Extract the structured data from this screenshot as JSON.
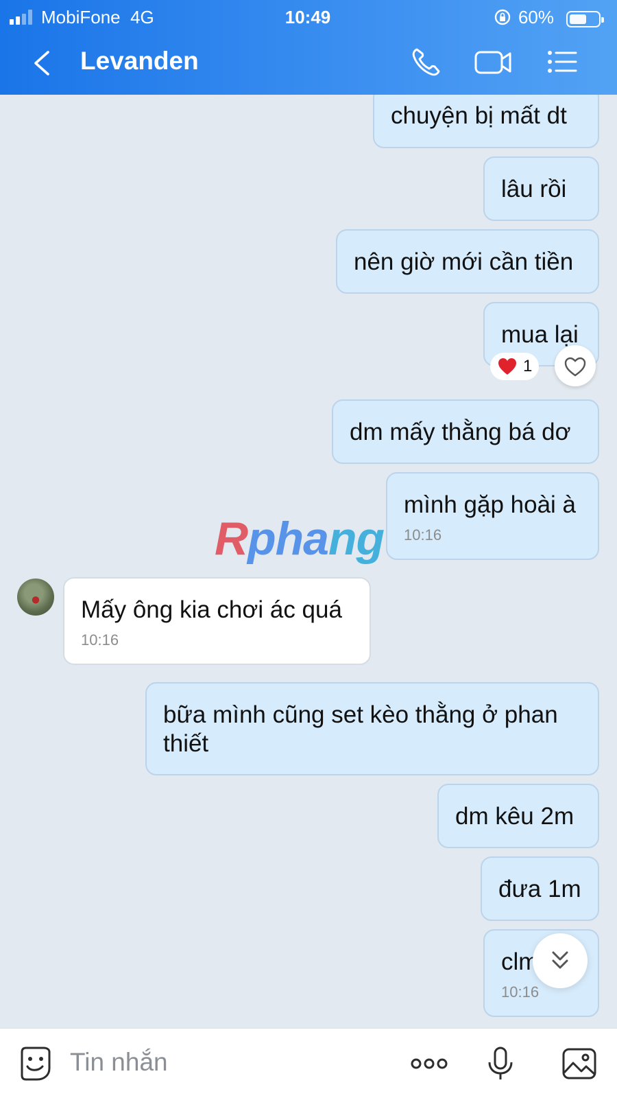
{
  "status_bar": {
    "carrier": "MobiFone",
    "network": "4G",
    "time": "10:49",
    "battery": "60%",
    "battery_level": 0.6,
    "signal_bars_active": 2
  },
  "header": {
    "contact_name": "Levanden",
    "icons": [
      "back-icon",
      "phone-icon",
      "video-call-icon",
      "menu-list-icon"
    ]
  },
  "messages": [
    {
      "dir": "out",
      "text": "chuyện bị mất dt",
      "time": ""
    },
    {
      "dir": "out",
      "text": "lâu rồi",
      "time": ""
    },
    {
      "dir": "out",
      "text": "nên giờ mới cần tiền",
      "time": ""
    },
    {
      "dir": "out",
      "text": "mua lại",
      "time": ""
    },
    {
      "dir": "out",
      "text": "dm mấy thằng bá dơ",
      "time": ""
    },
    {
      "dir": "out",
      "text": "mình gặp hoài à",
      "time": "10:16"
    },
    {
      "dir": "in",
      "text": "Mấy ông kia chơi ác quá",
      "time": "10:16"
    },
    {
      "dir": "out",
      "text": "bữa mình cũng set kèo thằng ở phan thiết",
      "time": ""
    },
    {
      "dir": "out",
      "text": "dm kêu 2m",
      "time": ""
    },
    {
      "dir": "out",
      "text": "đưa 1m",
      "time": ""
    },
    {
      "dir": "out",
      "text": "clmn",
      "time": "10:16"
    }
  ],
  "reaction": {
    "emoji": "❤️",
    "count": "1"
  },
  "watermark": "Rphang",
  "input_bar": {
    "placeholder": "Tin nhắn",
    "icons": [
      "emoji-sticker-icon",
      "more-dots-icon",
      "microphone-icon",
      "image-icon"
    ]
  },
  "colors": {
    "header_start": "#1a75e8",
    "header_end": "#52a2f4",
    "outgoing_bubble": "#d6ebfb",
    "incoming_bubble": "#ffffff",
    "chat_background": "#e3e9f0"
  }
}
